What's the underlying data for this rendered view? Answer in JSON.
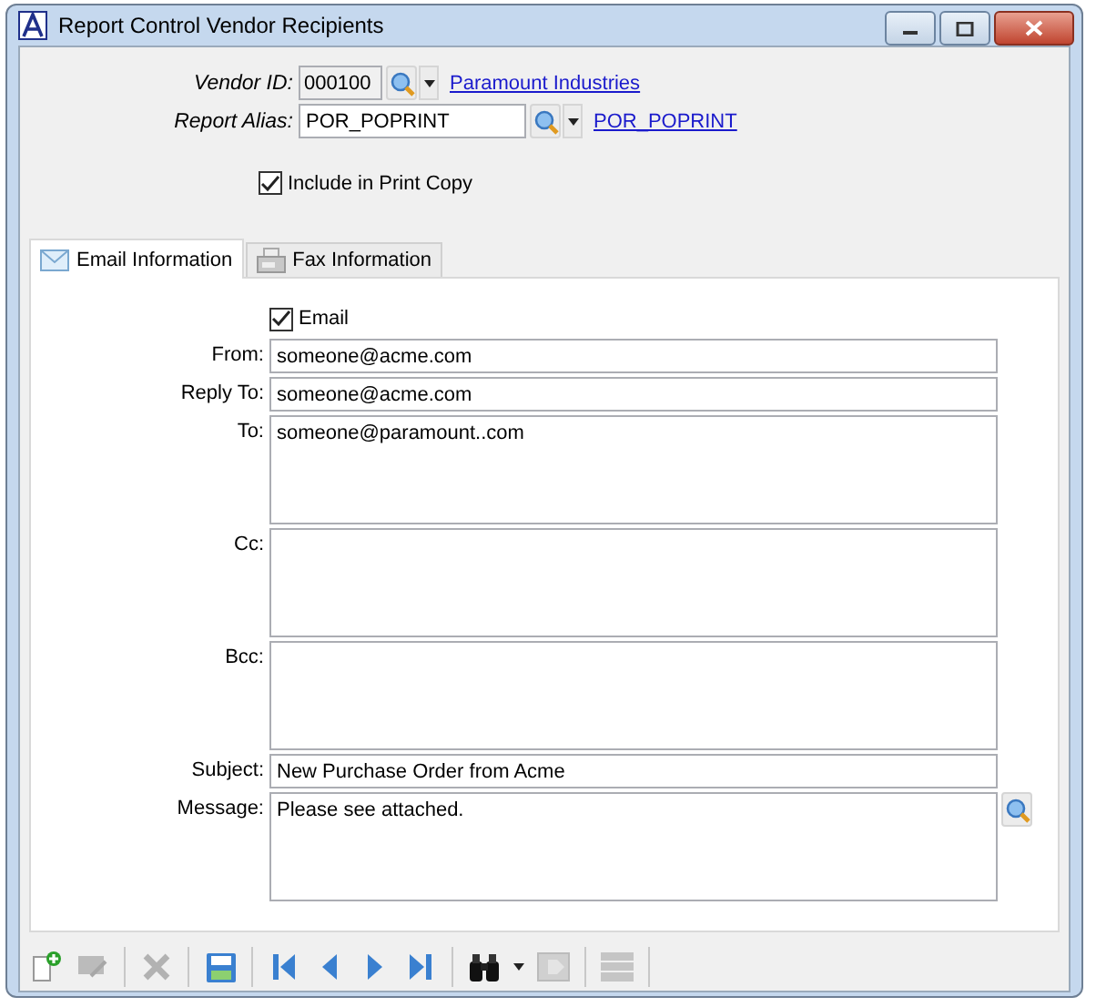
{
  "window": {
    "title": "Report Control Vendor Recipients"
  },
  "header_fields": [
    {
      "label": "Vendor ID:",
      "value": "000100",
      "readonly": true,
      "link": "Paramount Industries"
    },
    {
      "label": "Report Alias:",
      "value": "POR_POPRINT",
      "readonly": false,
      "link": "POR_POPRINT"
    }
  ],
  "include_in_print_copy": {
    "label": "Include in Print Copy",
    "checked": true
  },
  "tabs": [
    {
      "label": "Email Information",
      "kind": "email",
      "selected": true
    },
    {
      "label": "Fax Information",
      "kind": "fax",
      "selected": false
    }
  ],
  "email_checkbox": {
    "label": "Email",
    "checked": true
  },
  "email_fields": [
    {
      "label": "From:",
      "value": "someone@acme.com",
      "kind": "line"
    },
    {
      "label": "Reply To:",
      "value": "someone@acme.com",
      "kind": "line"
    },
    {
      "label": "To:",
      "value": "someone@paramount..com",
      "kind": "area"
    },
    {
      "label": "Cc:",
      "kind": "area"
    },
    {
      "label": "Bcc:",
      "kind": "area"
    },
    {
      "label": "Subject:",
      "value": "New Purchase Order from Acme",
      "kind": "line"
    },
    {
      "label": "Message:",
      "value": "Please see attached.",
      "kind": "message"
    }
  ],
  "toolbar": [
    {
      "kind": "new",
      "disabled": false
    },
    {
      "kind": "edit",
      "disabled": true
    },
    {
      "kind": "sep"
    },
    {
      "kind": "delete",
      "disabled": true
    },
    {
      "kind": "sep"
    },
    {
      "kind": "save",
      "disabled": false
    },
    {
      "kind": "sep"
    },
    {
      "kind": "first",
      "disabled": false
    },
    {
      "kind": "prev",
      "disabled": false
    },
    {
      "kind": "next",
      "disabled": false
    },
    {
      "kind": "last",
      "disabled": false
    },
    {
      "kind": "sep"
    },
    {
      "kind": "find",
      "disabled": false
    },
    {
      "kind": "dropdown",
      "disabled": false
    },
    {
      "kind": "import",
      "disabled": true
    },
    {
      "kind": "sep"
    },
    {
      "kind": "list",
      "disabled": true
    },
    {
      "kind": "sep"
    }
  ]
}
